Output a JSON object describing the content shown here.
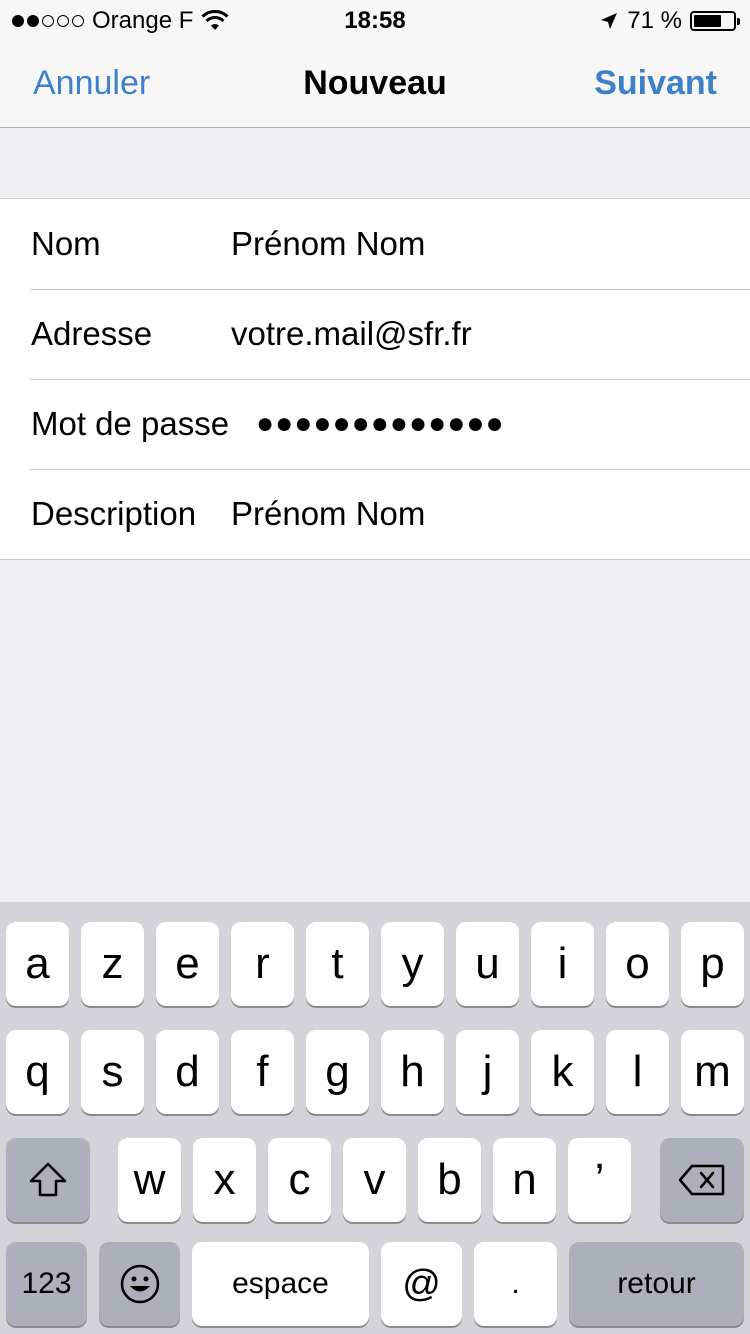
{
  "status": {
    "carrier": "Orange F",
    "time": "18:58",
    "battery": "71 %",
    "battery_level": 71,
    "signal_bars_on": 2,
    "signal_bars_total": 5
  },
  "nav": {
    "cancel": "Annuler",
    "title": "Nouveau",
    "next": "Suivant"
  },
  "form": {
    "rows": [
      {
        "label": "Nom",
        "value": "Prénom Nom"
      },
      {
        "label": "Adresse",
        "value": "votre.mail@sfr.fr"
      },
      {
        "label": "Mot de passe",
        "value": "●●●●●●●●●●●●●"
      },
      {
        "label": "Description",
        "value": "Prénom Nom"
      }
    ]
  },
  "keyboard": {
    "row1": [
      "a",
      "z",
      "e",
      "r",
      "t",
      "y",
      "u",
      "i",
      "o",
      "p"
    ],
    "row2": [
      "q",
      "s",
      "d",
      "f",
      "g",
      "h",
      "j",
      "k",
      "l",
      "m"
    ],
    "row3": [
      "w",
      "x",
      "c",
      "v",
      "b",
      "n",
      "’"
    ],
    "numbers": "123",
    "space": "espace",
    "at": "@",
    "dot": ".",
    "return": "retour"
  },
  "colors": {
    "accent": "#3f81c9",
    "background": "#efeff4",
    "keyboard_bg": "#d1d4d9",
    "dark_key": "#abb0ba"
  },
  "icons": {
    "shift": "shift-icon",
    "delete": "backspace-icon",
    "emoji": "emoji-icon",
    "wifi": "wifi-icon",
    "location": "location-arrow-icon",
    "battery": "battery-icon"
  }
}
